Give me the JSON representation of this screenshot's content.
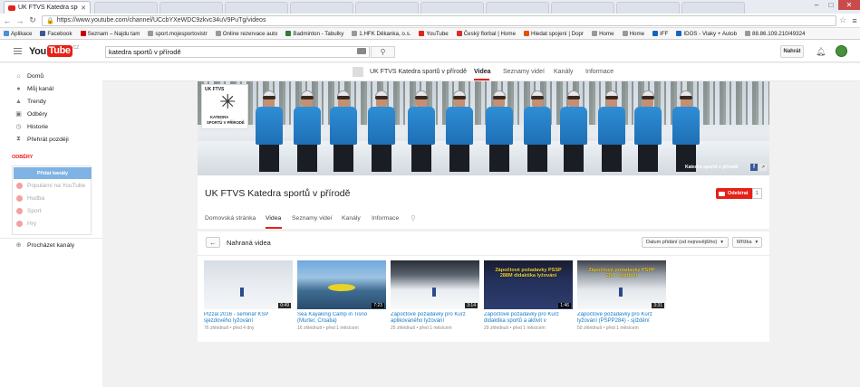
{
  "browser": {
    "tab_title": "UK FTVS Katedra sportů",
    "url": "https://www.youtube.com/channel/UCcbYXeWDC9zkvc34uV9PuTg/videos",
    "bookmarks": [
      {
        "label": "Aplikace",
        "color": "#4a8fd8"
      },
      {
        "label": "Facebook",
        "color": "#3b5998"
      },
      {
        "label": "Seznam – Najdu tam",
        "color": "#cc0000"
      },
      {
        "label": "sport.mojesportovistr",
        "color": "#999999"
      },
      {
        "label": "Online rezervace auto",
        "color": "#999999"
      },
      {
        "label": "Badminton - Tabulky",
        "color": "#2e7d32"
      },
      {
        "label": "1.HFK Děkanka, o.s.",
        "color": "#999999"
      },
      {
        "label": "YouTube",
        "color": "#e62117"
      },
      {
        "label": "Český florbal | Home",
        "color": "#d32f2f"
      },
      {
        "label": "Hledat spojení | Dopr",
        "color": "#e65100"
      },
      {
        "label": "Home",
        "color": "#999999"
      },
      {
        "label": "Home",
        "color": "#999999"
      },
      {
        "label": "IFF",
        "color": "#1565c0"
      },
      {
        "label": "IDOS - Vlaky + Autob",
        "color": "#1565c0"
      },
      {
        "label": "88.86.109.210/49324",
        "color": "#999999"
      }
    ]
  },
  "header": {
    "logo_you": "You",
    "logo_tube": "Tube",
    "logo_country": "CZ",
    "search_value": "katedra sportů v přírodě",
    "upload_label": "Nahrát"
  },
  "sidebar": {
    "items": [
      {
        "label": "Domů",
        "icon": "home-icon",
        "glyph": "⌂"
      },
      {
        "label": "Můj kanál",
        "icon": "user-icon",
        "glyph": "●"
      },
      {
        "label": "Trendy",
        "icon": "flame-icon",
        "glyph": "▲"
      },
      {
        "label": "Odběry",
        "icon": "subscriptions-icon",
        "glyph": "▣"
      },
      {
        "label": "Historie",
        "icon": "history-icon",
        "glyph": "◷"
      },
      {
        "label": "Přehrát později",
        "icon": "watch-later-icon",
        "glyph": "⧗"
      }
    ],
    "subscriptions_heading": "ODBĚRY",
    "add_channels_label": "Přidat kanály",
    "sub_items": [
      "Populární na YouTube",
      "Hudba",
      "Sport",
      "Hry"
    ],
    "browse_label": "Procházet kanály"
  },
  "channel_nav": {
    "name": "UK FTVS Katedra sportů v přírodě",
    "tabs": [
      "Videa",
      "Seznamy videí",
      "Kanály",
      "Informace"
    ],
    "active_tab": "Videa"
  },
  "channel": {
    "logo_line1": "UK FTVS",
    "logo_line2": "KATEDRA",
    "logo_line3": "SPORTŮ V PŘÍRODĚ",
    "banner_caption": "Katedra sportů v přírodě",
    "title": "UK FTVS Katedra sportů v přírodě",
    "subscribe_label": "Odebírat",
    "subscriber_count": "1",
    "tabs": [
      "Domovská stránka",
      "Videa",
      "Seznamy videí",
      "Kanály",
      "Informace"
    ],
    "active_tab": "Videa"
  },
  "videos": {
    "heading": "Nahraná videa",
    "sort_label": "Datum přidání (od nejnovějšího)",
    "view_label": "Mřížka",
    "items": [
      {
        "title": "Pizzal 2016 - seminář KSP sjezdového lyžování",
        "duration": "0:49",
        "views": "76 zhlédnutí",
        "age": "před 4 dny"
      },
      {
        "title": "Sea Kayaking Camp in Tisno (Murter, Croatia)",
        "duration": "7:23",
        "views": "16 zhlédnutí",
        "age": "před 1 měsícem"
      },
      {
        "title": "Zápočtové požadavky pro Kurz aplikovaného lyžování",
        "duration": "3:14",
        "views": "25 zhlédnutí",
        "age": "před 1 měsícem"
      },
      {
        "title": "Zápočtové požadavky pro Kurz didaktika sportů a aktivit v",
        "duration": "1:46",
        "views": "29 zhlédnutí",
        "age": "před 1 měsícem",
        "overlay": "Zápočtové požadavky PSSP 288M didaktika lyžování"
      },
      {
        "title": "Zápočtové požadavky pro Kurz lyžování (PSPP284) - sjíždění",
        "duration": "3:31",
        "views": "50 zhlédnutí",
        "age": "před 1 měsícem",
        "overlay": "Zápočtové požadavky PSPP 284 - sjíždění"
      }
    ]
  }
}
